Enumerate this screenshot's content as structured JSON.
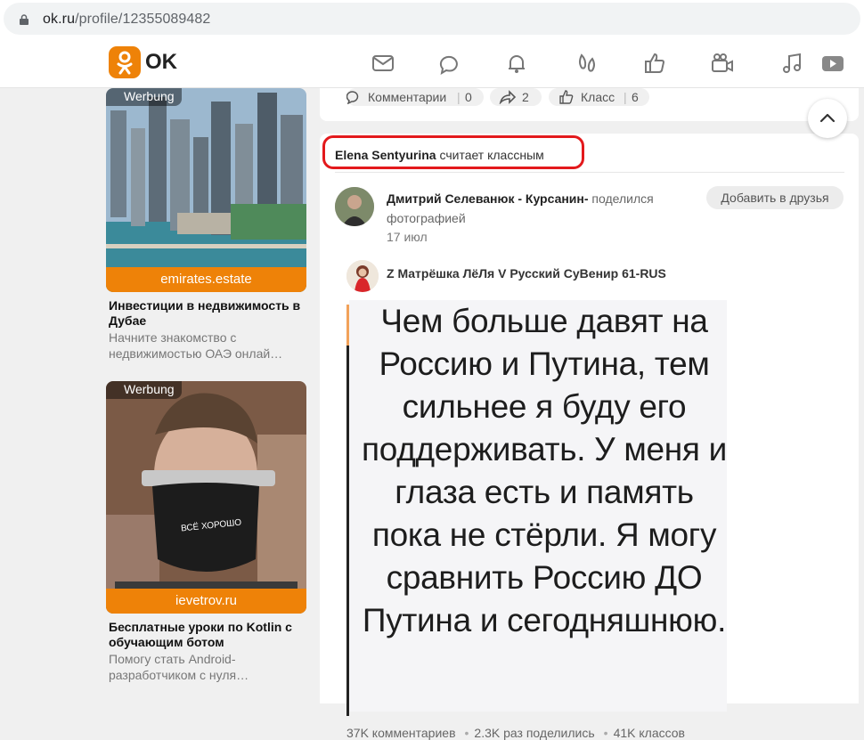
{
  "browser": {
    "url_host": "ok.ru",
    "url_path": "/profile/12355089482"
  },
  "brand": {
    "logo_text": "OK",
    "accent": "#ee8208"
  },
  "nav_icons": [
    "messages-icon",
    "discussions-icon",
    "notifications-icon",
    "guests-icon",
    "likes-icon",
    "video-icon",
    "music-icon",
    "video-play-icon"
  ],
  "ads": [
    {
      "tag": "Werbung",
      "domain": "emirates.estate",
      "title": "Инвестиции в недвижимость в Дубае",
      "desc": "Начните знакомство с недвижимостью ОАЭ онлай…"
    },
    {
      "tag": "Werbung",
      "domain": "ievetrov.ru",
      "title": "Бесплатные уроки по Kotlin с обучающим ботом",
      "desc": "Помогу стать Android-разработчиком с нуля…",
      "mask_text": "ВСЁ ХОРОШО"
    }
  ],
  "prev_post": {
    "comments_label": "Комментарии",
    "comments_count": "0",
    "shares_count": "2",
    "class_label": "Класс",
    "class_count": "6"
  },
  "feed_item": {
    "liker_name": "Elena Sentyurina",
    "liker_action": "считает классным",
    "author_name": "Дмитрий Селеванюк - Курсанин-",
    "author_action": "поделился фотографией",
    "date": "17 июл",
    "add_friend_label": "Добавить в друзья",
    "repost_author": "Z Матрёшка ЛёЛя V Русский СуВенир 61-RUS",
    "image_text": "Чем больше давят на Россию и Путина, тем сильнее я буду его поддерживать. У меня и глаза есть и память пока не стёрли. Я могу сравнить Россию ДО Путина и сегодняшнюю.",
    "comments_stat": "37K комментариев",
    "shares_stat": "2.3K раз поделились",
    "classes_stat": "41K классов"
  }
}
